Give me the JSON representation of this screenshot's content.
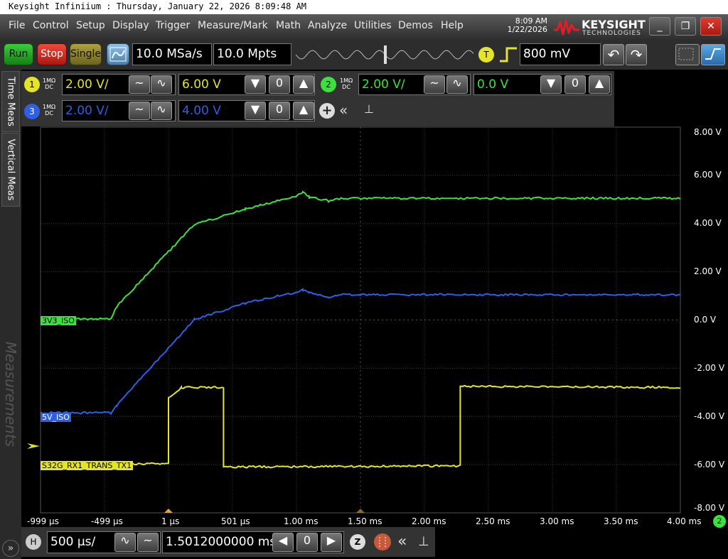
{
  "window": {
    "title": "Keysight Infiniium : Thursday, January 22, 2026 8:09:48 AM"
  },
  "menu": [
    "File",
    "Control",
    "Setup",
    "Display",
    "Trigger",
    "Measure/Mark",
    "Math",
    "Analyze",
    "Utilities",
    "Demos",
    "Help"
  ],
  "clock": {
    "time": "8:09 AM",
    "date": "1/22/2026"
  },
  "brand": {
    "name": "KEYSIGHT",
    "sub": "TECHNOLOGIES",
    "color": "#e01e26"
  },
  "window_buttons": {
    "minimize": "_",
    "restore": "❐",
    "close": "✕"
  },
  "acquisition": {
    "run": "Run",
    "stop": "Stop",
    "single": "Single",
    "sample_rate": "10.0 MSa/s",
    "memory_depth": "10.0 Mpts"
  },
  "trigger": {
    "badge": "T",
    "level": "800 mV"
  },
  "side_tabs": {
    "time_meas": "Time Meas",
    "vertical_meas": "Vertical Meas",
    "measurements": "Measurements"
  },
  "channels": [
    {
      "num": "1",
      "coupling_top": "1MΩ",
      "coupling_bottom": "DC",
      "scale": "2.00 V/",
      "offset": "6.00 V",
      "color": "#e4e42a",
      "label": "S32G_RX1_TRANS_TX1"
    },
    {
      "num": "2",
      "coupling_top": "1MΩ",
      "coupling_bottom": "DC",
      "scale": "2.00 V/",
      "offset": "0.0 V",
      "color": "#3be23b",
      "label": "3V3_ISO"
    },
    {
      "num": "3",
      "coupling_top": "1MΩ",
      "coupling_bottom": "DC",
      "scale": "2.00 V/",
      "offset": "4.00 V",
      "color": "#2f5fe6",
      "label": "5V_ISO"
    }
  ],
  "grid": {
    "y_ticks": [
      "8.00 V",
      "6.00 V",
      "4.00 V",
      "2.00 V",
      "0.0 V",
      "-2.00 V",
      "-4.00 V",
      "-6.00 V",
      "-8.00 V"
    ],
    "x_ticks": [
      "-999 µs",
      "-499 µs",
      "1 µs",
      "501 µs",
      "1.00 ms",
      "1.50 ms",
      "2.00 ms",
      "2.50 ms",
      "3.00 ms",
      "3.50 ms",
      "4.00 ms"
    ],
    "scale_badge": "2"
  },
  "timebase": {
    "badge": "H",
    "scale": "500 µs/",
    "position": "1.5012000000 ms",
    "zoom": "Z"
  },
  "chart_data": {
    "type": "line",
    "x_unit": "ms",
    "y_unit": "V",
    "xlim": [
      -1.0,
      4.0
    ],
    "ylim": [
      -8.0,
      8.0
    ],
    "series": [
      {
        "name": "3V3_ISO",
        "color": "#3be23b",
        "points": [
          [
            -1.0,
            0.05
          ],
          [
            -0.45,
            0.05
          ],
          [
            -0.4,
            0.6
          ],
          [
            0.2,
            3.95
          ],
          [
            0.6,
            4.6
          ],
          [
            1.0,
            5.15
          ],
          [
            1.05,
            5.3
          ],
          [
            1.1,
            5.1
          ],
          [
            1.25,
            4.95
          ],
          [
            1.35,
            5.05
          ],
          [
            1.5,
            5.05
          ],
          [
            4.0,
            5.05
          ]
        ]
      },
      {
        "name": "5V_ISO",
        "color": "#2f5fe6",
        "points": [
          [
            -1.0,
            -3.85
          ],
          [
            -0.45,
            -3.85
          ],
          [
            -0.4,
            -3.5
          ],
          [
            0.2,
            0.0
          ],
          [
            0.6,
            0.7
          ],
          [
            1.0,
            1.15
          ],
          [
            1.05,
            1.25
          ],
          [
            1.1,
            1.15
          ],
          [
            1.25,
            0.95
          ],
          [
            1.35,
            1.05
          ],
          [
            1.5,
            1.05
          ],
          [
            4.0,
            1.05
          ]
        ]
      },
      {
        "name": "S32G_RX1_TRANS_TX1",
        "color": "#e4e42a",
        "points": [
          [
            -1.0,
            -6.0
          ],
          [
            0.0,
            -5.95
          ],
          [
            0.0,
            -3.25
          ],
          [
            0.1,
            -2.8
          ],
          [
            0.43,
            -2.8
          ],
          [
            0.43,
            -6.1
          ],
          [
            2.28,
            -6.05
          ],
          [
            2.28,
            -2.75
          ],
          [
            4.0,
            -2.8
          ]
        ]
      }
    ]
  }
}
